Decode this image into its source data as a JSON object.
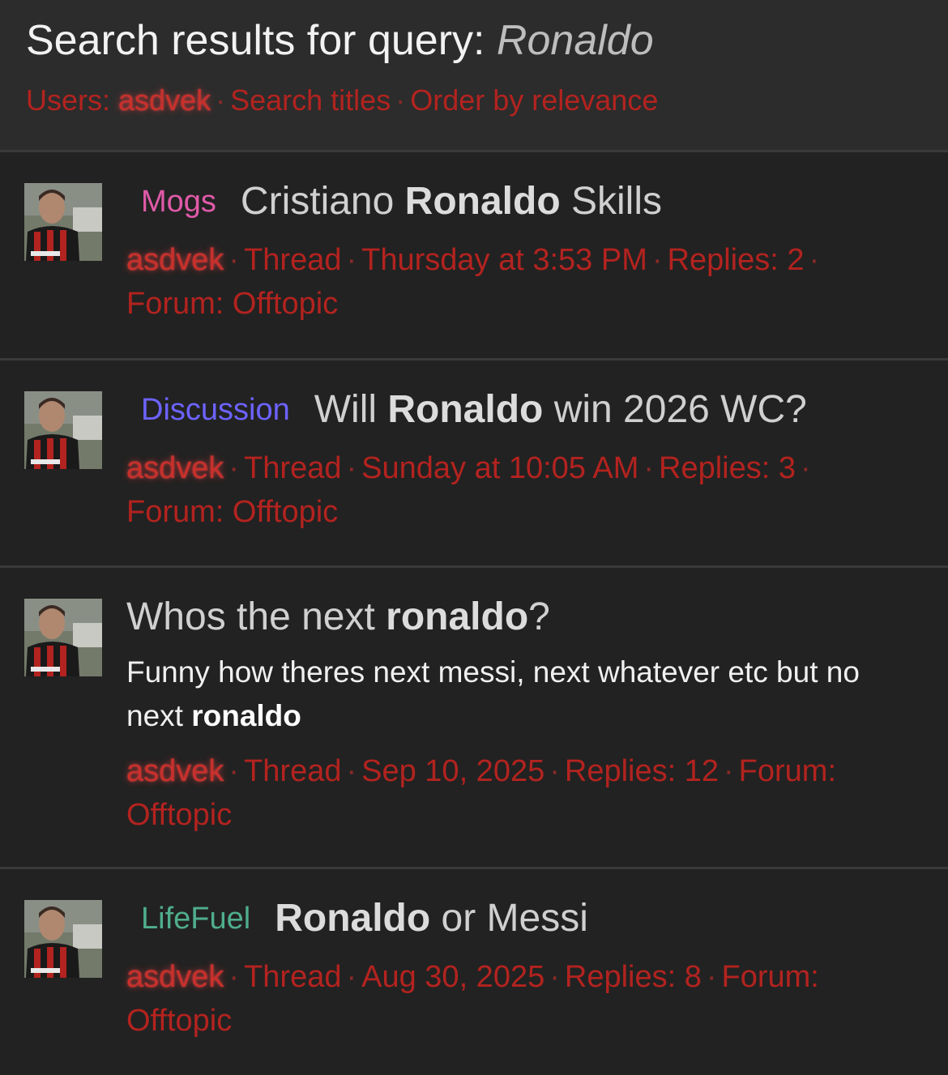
{
  "header": {
    "title_prefix": "Search results for query:",
    "query": "Ronaldo",
    "filters": {
      "users_label": "Users:",
      "user": "asdvek",
      "search_titles": "Search titles",
      "order": "Order by relevance"
    }
  },
  "separator": "·",
  "results": [
    {
      "prefix": "Mogs",
      "prefix_color": "#e05aa8",
      "title_before": "Cristiano ",
      "title_bold": "Ronaldo",
      "title_after": " Skills",
      "author": "asdvek",
      "type": "Thread",
      "date": "Thursday at 3:53 PM",
      "replies": "Replies: 2",
      "forum": "Forum: Offtopic"
    },
    {
      "prefix": "Discussion",
      "prefix_color": "#6c63ff",
      "title_before": "Will ",
      "title_bold": "Ronaldo",
      "title_after": " win 2026 WC?",
      "author": "asdvek",
      "type": "Thread",
      "date": "Sunday at 10:05 AM",
      "replies": "Replies: 3",
      "forum": "Forum: Offtopic"
    },
    {
      "prefix": "",
      "title_before": "Whos the next ",
      "title_bold": "ronaldo",
      "title_after": "?",
      "snippet_before": "Funny how theres next messi, next whatever etc but no next ",
      "snippet_bold": "ronaldo",
      "author": "asdvek",
      "type": "Thread",
      "date": "Sep 10, 2025",
      "replies": "Replies: 12",
      "forum": "Forum: Offtopic"
    },
    {
      "prefix": "LifeFuel",
      "prefix_color": "#4fae8c",
      "title_before": "",
      "title_bold": "Ronaldo",
      "title_after": " or Messi",
      "author": "asdvek",
      "type": "Thread",
      "date": "Aug 30, 2025",
      "replies": "Replies: 8",
      "forum": "Forum: Offtopic"
    }
  ]
}
